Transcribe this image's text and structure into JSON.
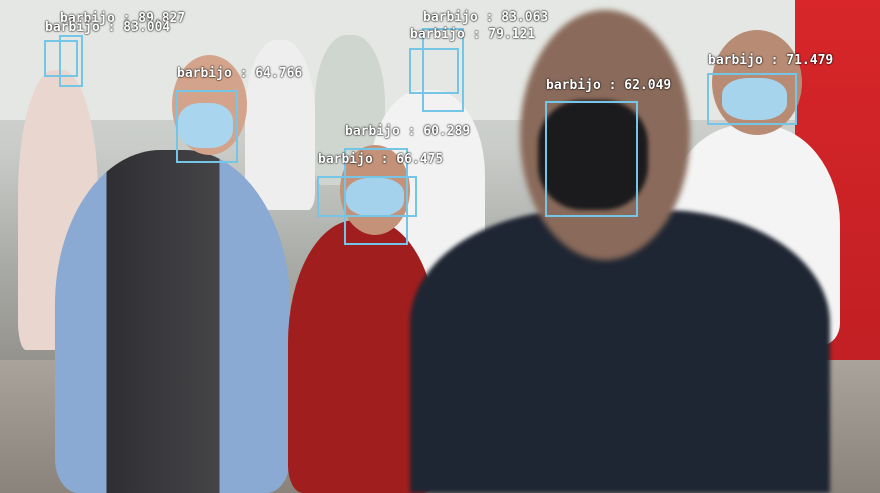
{
  "image": {
    "description_icon": "photo-crowd-wearing-face-masks",
    "box_color": "#74c5e6",
    "label_color": "#ffffff"
  },
  "detections": [
    {
      "id": "d1",
      "text": "barbijo : 89.827"
    },
    {
      "id": "d2",
      "text": "barbijo : 83.004"
    },
    {
      "id": "d3",
      "text": "barbijo : 83.063"
    },
    {
      "id": "d4",
      "text": "barbijo : 79.121"
    },
    {
      "id": "d5",
      "text": "barbijo : 71.479"
    },
    {
      "id": "d6",
      "text": "barbijo : 64.766"
    },
    {
      "id": "d7",
      "text": "barbijo : 62.049"
    },
    {
      "id": "d8",
      "text": "barbijo : 60.289"
    },
    {
      "id": "d9",
      "text": "barbijo : 66.475"
    }
  ]
}
